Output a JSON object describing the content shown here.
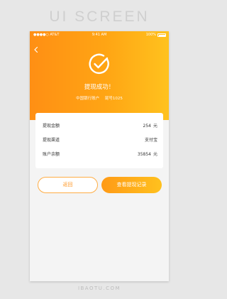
{
  "brand_title": "UI SCREEN",
  "watermark": "IBAOTU.COM",
  "status_bar": {
    "carrier": "●●●●○ AT&T",
    "time": "9:41 AM",
    "battery": "100%"
  },
  "header": {
    "title": "提现成功！",
    "bank_name": "中国银行账户",
    "tail_number": "尾号1025"
  },
  "details": [
    {
      "label": "提现金额",
      "value": "254",
      "unit": "元"
    },
    {
      "label": "提现渠道",
      "value": "支付宝",
      "unit": ""
    },
    {
      "label": "账户余额",
      "value": "35854",
      "unit": "元"
    }
  ],
  "buttons": {
    "back_label": "返回",
    "record_label": "查看提现记录"
  },
  "colors": {
    "gradient_start": "#ff8f14",
    "gradient_end": "#ffc21e",
    "accent": "#ff9a2a",
    "background": "#f4f4f4"
  }
}
